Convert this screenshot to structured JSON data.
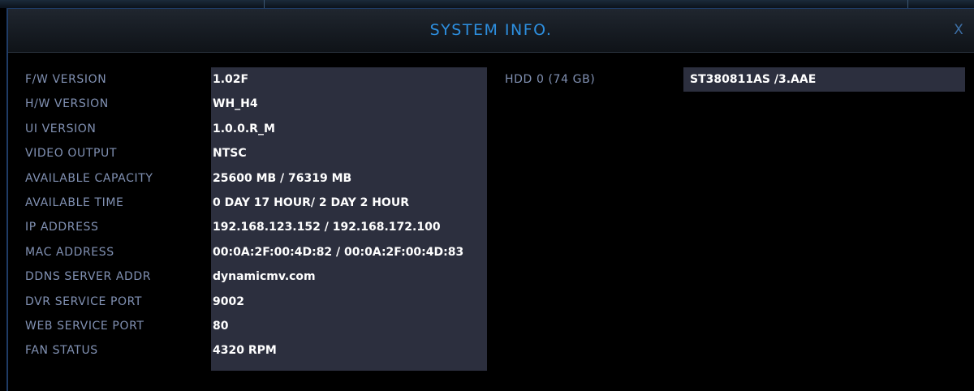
{
  "window": {
    "title": "SYSTEM INFO.",
    "close_label": "X"
  },
  "info_rows": [
    {
      "label": "F/W VERSION",
      "value": "1.02F"
    },
    {
      "label": "H/W VERSION",
      "value": "WH_H4"
    },
    {
      "label": "UI VERSION",
      "value": "1.0.0.R_M"
    },
    {
      "label": "VIDEO OUTPUT",
      "value": "NTSC"
    },
    {
      "label": "AVAILABLE CAPACITY",
      "value": "25600 MB / 76319 MB"
    },
    {
      "label": "AVAILABLE TIME",
      "value": "0 DAY 17 HOUR/ 2 DAY 2 HOUR"
    },
    {
      "label": "IP ADDRESS",
      "value": "192.168.123.152 / 192.168.172.100"
    },
    {
      "label": "MAC ADDRESS",
      "value": "00:0A:2F:00:4D:82 / 00:0A:2F:00:4D:83"
    },
    {
      "label": "DDNS SERVER ADDR",
      "value": "dynamicmv.com"
    },
    {
      "label": "DVR SERVICE PORT",
      "value": "9002"
    },
    {
      "label": "WEB SERVICE PORT",
      "value": "80"
    },
    {
      "label": "FAN STATUS",
      "value": "4320 RPM"
    }
  ],
  "hdd": {
    "label": "HDD 0 (74 GB)",
    "value": "ST380811AS /3.AAE"
  },
  "colors": {
    "title": "#2d8fe0",
    "label": "#8191b3",
    "value": "#ffffff",
    "value_background": "#2c2f3e",
    "panel_border": "#1f3c66"
  }
}
